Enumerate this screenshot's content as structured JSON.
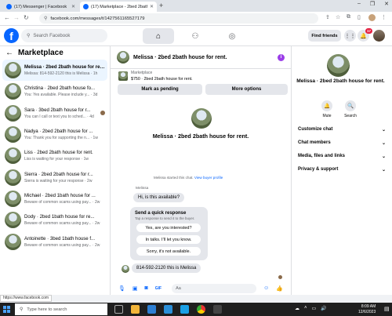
{
  "browser": {
    "tabs": [
      {
        "title": "(17) Messenger | Facebook"
      },
      {
        "title": "(17) Marketplace - 2bed 2bath"
      }
    ],
    "new_tab": "+",
    "window_controls": [
      "–",
      "❐",
      "✕"
    ],
    "url": "facebook.com/messages/t/1427561165527179"
  },
  "fb": {
    "logo": "f",
    "search_placeholder": "Search Facebook",
    "find_friends": "Find friends",
    "notification_count": "17"
  },
  "left_panel": {
    "back": "←",
    "title": "Marketplace",
    "conversations": [
      {
        "name": "Melissa · 2bed 2bath house for rent.",
        "preview": "Melissa: 814-592-2120 this is Melissa · 1h"
      },
      {
        "name": "Christina · 2bed 2bath house fo...",
        "preview": "You: Yes available. Please include y... · 3d"
      },
      {
        "name": "Sara · 3bed 2bath house for r...",
        "preview": "You can I call or text you to sched... · 4d"
      },
      {
        "name": "Nadya · 2bed 2bath house for ...",
        "preview": "You: Thank you for supporting the n... · 1w"
      },
      {
        "name": "Liss · 2bed 2bath house for rent.",
        "preview": "Liss is waiting for your response · 1w"
      },
      {
        "name": "Sierra · 2bed 2bath house for r...",
        "preview": "Sierra is waiting for your response · 2w"
      },
      {
        "name": "Michael · 2bed 1bath house for ...",
        "preview": "Beware of common scams using pay... · 2w"
      },
      {
        "name": "Dody · 2bed 1bath house for re...",
        "preview": "Beware of common scams using pay... · 2w"
      },
      {
        "name": "Antoinette · 3bed 1bath house f...",
        "preview": "Beware of common scams using pay... · 2w"
      }
    ]
  },
  "chat": {
    "header_name": "Melissa · 2bed 2bath house for rent.",
    "info_icon": "i",
    "marketplace_label": "Marketplace",
    "listing": "$750 · 2bed 2bath house for rent.",
    "mark_pending": "Mark as pending",
    "more_options": "More options",
    "big_name": "Melissa · 2bed 2bath house for rent.",
    "started_text": "Melissa started this chat.",
    "view_profile": "View buyer profile",
    "sender": "Melissa",
    "first_message": "Hi, is this available?",
    "quick_title": "Send a quick response",
    "quick_sub": "Tap a response to send it to the buyer.",
    "quick_replies": [
      "Yes, are you interested?",
      "In talks. I'll let you know.",
      "Sorry, it's not available."
    ],
    "last_message": "814-592-2120 this is Melissa",
    "input_placeholder": "Aa"
  },
  "right_panel": {
    "name": "Melissa · 2bed 2bath house for rent.",
    "actions": [
      {
        "label": "Mute",
        "icon": "🔔"
      },
      {
        "label": "Search",
        "icon": "🔍"
      }
    ],
    "sections": [
      "Customize chat",
      "Chat members",
      "Media, files and links",
      "Privacy & support"
    ]
  },
  "status_url": "https://www.facebook.com",
  "taskbar": {
    "search_placeholder": "Type here to search",
    "time": "8:09 AM",
    "date": "12/6/2023"
  }
}
